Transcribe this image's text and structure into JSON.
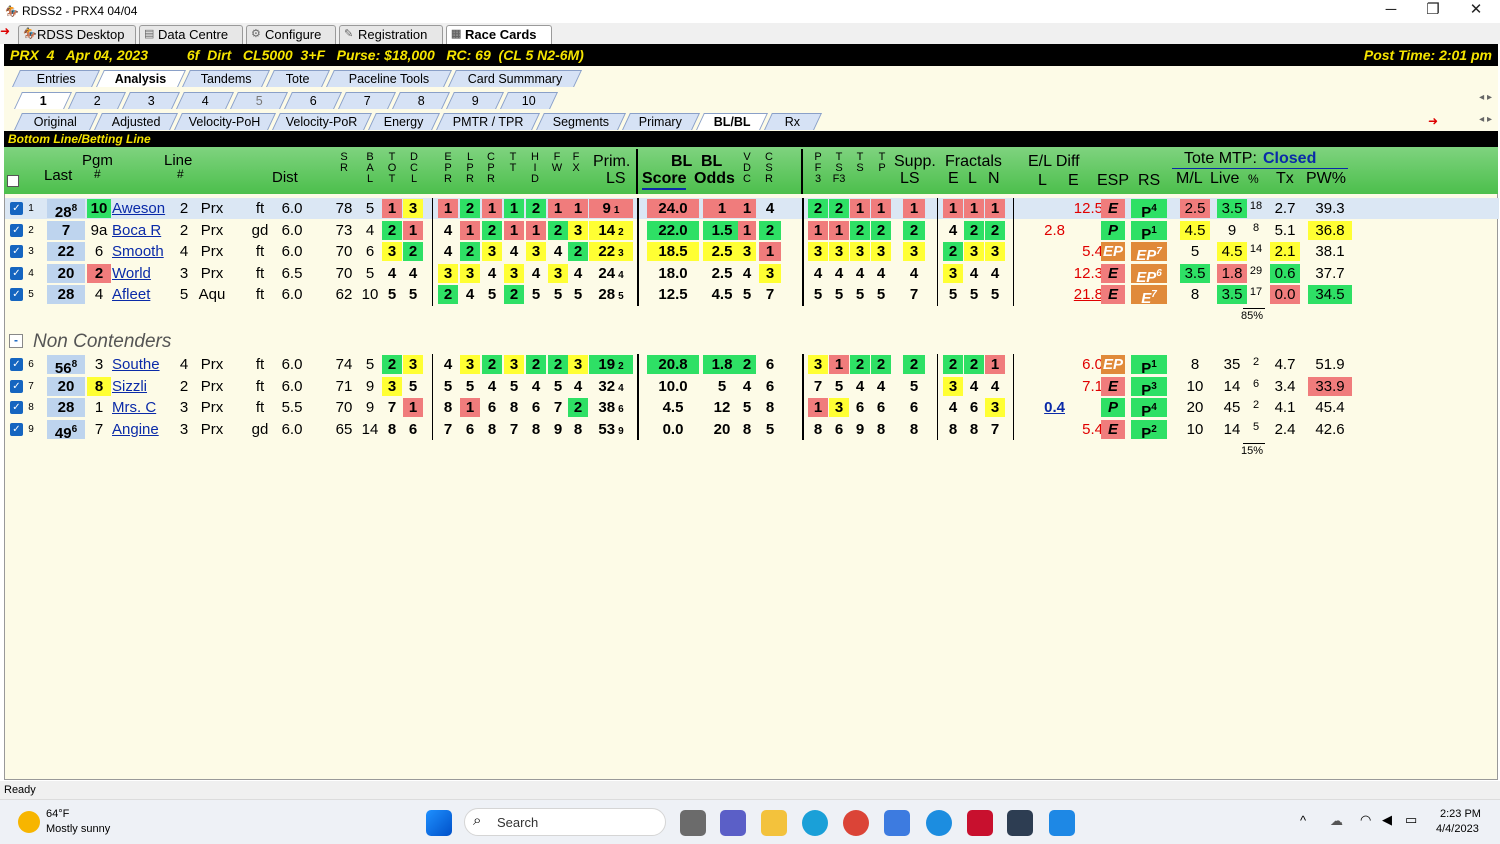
{
  "window": {
    "title": "RDSS2 - PRX4  04/04",
    "minimize": "─",
    "maximize": "❐",
    "close": "✕"
  },
  "app_tabs": [
    "RDSS Desktop",
    "Data Centre",
    "Configure",
    "Registration",
    "Race Cards"
  ],
  "race": {
    "left": "PRX  4   Apr 04, 2023          6f  Dirt   CL5000  3+F   Purse: $18,000   RC: 69  (CL 5 N2-6M)",
    "post": "Post Time: 2:01 pm"
  },
  "main_tabs": [
    "Entries",
    "Analysis",
    "Tandems",
    "Tote",
    "Paceline Tools",
    "Card Summmary"
  ],
  "race_tabs": [
    "1",
    "2",
    "3",
    "4",
    "5",
    "6",
    "7",
    "8",
    "9",
    "10"
  ],
  "view_tabs": [
    "Original",
    "Adjusted",
    "Velocity-PoH",
    "Velocity-PoR",
    "Energy",
    "PMTR / TPR",
    "Segments",
    "Primary",
    "BL/BL",
    "Rx"
  ],
  "section_title": "Bottom Line/Betting Line",
  "headers": {
    "last": "Last",
    "pgm": "Pgm",
    "pgm_sub": "#",
    "line": "Line",
    "line_sub": "#",
    "dist": "Dist",
    "sr": [
      "S",
      "R"
    ],
    "bal": [
      "B",
      "A",
      "L"
    ],
    "tot": [
      "T",
      "O",
      "T"
    ],
    "dcl": [
      "D",
      "C",
      "L"
    ],
    "epr": [
      "E",
      "P",
      "R"
    ],
    "lpr": [
      "L",
      "P",
      "R"
    ],
    "cpr": [
      "C",
      "P",
      "R"
    ],
    "tt": [
      "T",
      "T"
    ],
    "hid": [
      "H",
      "I",
      "D"
    ],
    "fw": [
      "F",
      "W"
    ],
    "fx": [
      "F",
      "X"
    ],
    "prim": "Prim.",
    "prim_ls": "LS",
    "bl1": "BL",
    "bl2": "BL",
    "score": "Score",
    "odds": "Odds",
    "vdc": [
      "V",
      "D",
      "C"
    ],
    "csr": [
      "C",
      "S",
      "R"
    ],
    "pf3": [
      "P",
      "F",
      "3"
    ],
    "ts": [
      "T",
      "S",
      "F3"
    ],
    "tss": [
      "T",
      "S"
    ],
    "tp": [
      "T",
      "P"
    ],
    "supp": "Supp.",
    "supp_ls": "LS",
    "fractals": "Fractals",
    "fe": "E",
    "fl": "L",
    "fn": "N",
    "eldiff": "E/L Diff",
    "el_l": "L",
    "el_e": "E",
    "esp": "ESP",
    "rs": "RS",
    "tote": "Tote MTP:",
    "tote_status": "Closed",
    "ml": "M/L",
    "live": "Live",
    "pct": "%",
    "tx": "Tx",
    "pw": "PW%"
  },
  "contenders": [
    {
      "n": "1",
      "last": "28",
      "last_sup": "8",
      "pgm": "10",
      "horse": "Aweson",
      "line": "2",
      "trk": "Prx",
      "cond": "ft",
      "dist": "6.0",
      "sr": "78",
      "bal": "5",
      "tot": "1",
      "dcl": "3",
      "epr": "1",
      "lpr": "2",
      "cpr": "1",
      "tt": "1",
      "hid": "2",
      "fw": "1",
      "fx": "1",
      "prim": "9",
      "prim_r": "1",
      "score": "24.0",
      "odds": "1",
      "vdc": "1",
      "csr": "4",
      "pf3": "2",
      "ts": "2",
      "tss": "1",
      "tp": "1",
      "supp": "1",
      "fe": "1",
      "fl": "1",
      "fn": "1",
      "el_l": "",
      "el_e": "12.5",
      "esp": "E",
      "rs": "P",
      "rs_sup": "4",
      "ml": "2.5",
      "live": "3.5",
      "pct": "18",
      "tx": "2.7",
      "pw": "39.3"
    },
    {
      "n": "2",
      "last": "7",
      "last_sup": "",
      "pgm": "9a",
      "horse": "Boca R",
      "line": "2",
      "trk": "Prx",
      "cond": "gd",
      "dist": "6.0",
      "sr": "73",
      "bal": "4",
      "tot": "2",
      "dcl": "1",
      "epr": "4",
      "lpr": "1",
      "cpr": "2",
      "tt": "1",
      "hid": "1",
      "fw": "2",
      "fx": "3",
      "prim": "14",
      "prim_r": "2",
      "score": "22.0",
      "odds": "1.5",
      "vdc": "1",
      "csr": "2",
      "pf3": "1",
      "ts": "1",
      "tss": "2",
      "tp": "2",
      "supp": "2",
      "fe": "4",
      "fl": "2",
      "fn": "2",
      "el_l": "2.8",
      "el_e": "",
      "esp": "P",
      "rs": "P",
      "rs_sup": "1",
      "ml": "4.5",
      "live": "9",
      "pct": "8",
      "tx": "5.1",
      "pw": "36.8"
    },
    {
      "n": "3",
      "last": "22",
      "last_sup": "",
      "pgm": "6",
      "horse": "Smooth",
      "line": "4",
      "trk": "Prx",
      "cond": "ft",
      "dist": "6.0",
      "sr": "70",
      "bal": "6",
      "tot": "3",
      "dcl": "2",
      "epr": "4",
      "lpr": "2",
      "cpr": "3",
      "tt": "4",
      "hid": "3",
      "fw": "4",
      "fx": "2",
      "prim": "22",
      "prim_r": "3",
      "score": "18.5",
      "odds": "2.5",
      "vdc": "3",
      "csr": "1",
      "pf3": "3",
      "ts": "3",
      "tss": "3",
      "tp": "3",
      "supp": "3",
      "fe": "2",
      "fl": "3",
      "fn": "3",
      "el_l": "",
      "el_e": "5.4",
      "esp": "EP",
      "rs": "EP",
      "rs_sup": "7",
      "ml": "5",
      "live": "4.5",
      "pct": "14",
      "tx": "2.1",
      "pw": "38.1"
    },
    {
      "n": "4",
      "last": "20",
      "last_sup": "",
      "pgm": "2",
      "horse": "World",
      "line": "3",
      "trk": "Prx",
      "cond": "ft",
      "dist": "6.5",
      "sr": "70",
      "bal": "5",
      "tot": "4",
      "dcl": "4",
      "epr": "3",
      "lpr": "3",
      "cpr": "4",
      "tt": "3",
      "hid": "4",
      "fw": "3",
      "fx": "4",
      "prim": "24",
      "prim_r": "4",
      "score": "18.0",
      "odds": "2.5",
      "vdc": "4",
      "csr": "3",
      "pf3": "4",
      "ts": "4",
      "tss": "4",
      "tp": "4",
      "supp": "4",
      "fe": "3",
      "fl": "4",
      "fn": "4",
      "el_l": "",
      "el_e": "12.3",
      "esp": "E",
      "rs": "EP",
      "rs_sup": "6",
      "ml": "3.5",
      "live": "1.8",
      "pct": "29",
      "tx": "0.6",
      "pw": "37.7"
    },
    {
      "n": "5",
      "last": "28",
      "last_sup": "",
      "pgm": "4",
      "horse": "Afleet",
      "line": "5",
      "trk": "Aqu",
      "cond": "ft",
      "dist": "6.0",
      "sr": "62",
      "bal": "10",
      "tot": "5",
      "dcl": "5",
      "epr": "2",
      "lpr": "4",
      "cpr": "5",
      "tt": "2",
      "hid": "5",
      "fw": "5",
      "fx": "5",
      "prim": "28",
      "prim_r": "5",
      "score": "12.5",
      "odds": "4.5",
      "vdc": "5",
      "csr": "7",
      "pf3": "5",
      "ts": "5",
      "tss": "5",
      "tp": "5",
      "supp": "7",
      "fe": "5",
      "fl": "5",
      "fn": "5",
      "el_l": "",
      "el_e": "21.8",
      "esp": "E",
      "rs": "E",
      "rs_sup": "7",
      "ml": "8",
      "live": "3.5",
      "pct": "17",
      "tx": "0.0",
      "pw": "34.5"
    }
  ],
  "contenders_total": "85%",
  "non_contenders_label": "Non Contenders",
  "collapse": "-",
  "non_contenders": [
    {
      "n": "6",
      "last": "56",
      "last_sup": "8",
      "pgm": "3",
      "horse": "Southe",
      "line": "4",
      "trk": "Prx",
      "cond": "ft",
      "dist": "6.0",
      "sr": "74",
      "bal": "5",
      "tot": "2",
      "dcl": "3",
      "epr": "4",
      "lpr": "3",
      "cpr": "2",
      "tt": "3",
      "hid": "2",
      "fw": "2",
      "fx": "3",
      "prim": "19",
      "prim_r": "2",
      "score": "20.8",
      "odds": "1.8",
      "vdc": "2",
      "csr": "6",
      "pf3": "3",
      "ts": "1",
      "tss": "2",
      "tp": "2",
      "supp": "2",
      "fe": "2",
      "fl": "2",
      "fn": "1",
      "el_l": "",
      "el_e": "6.0",
      "esp": "EP",
      "rs": "P",
      "rs_sup": "1",
      "ml": "8",
      "live": "35",
      "pct": "2",
      "tx": "4.7",
      "pw": "51.9"
    },
    {
      "n": "7",
      "last": "20",
      "last_sup": "",
      "pgm": "8",
      "horse": "Sizzli",
      "line": "2",
      "trk": "Prx",
      "cond": "ft",
      "dist": "6.0",
      "sr": "71",
      "bal": "9",
      "tot": "3",
      "dcl": "5",
      "epr": "5",
      "lpr": "5",
      "cpr": "4",
      "tt": "5",
      "hid": "4",
      "fw": "5",
      "fx": "4",
      "prim": "32",
      "prim_r": "4",
      "score": "10.0",
      "odds": "5",
      "vdc": "4",
      "csr": "6",
      "pf3": "7",
      "ts": "5",
      "tss": "4",
      "tp": "4",
      "supp": "5",
      "fe": "3",
      "fl": "4",
      "fn": "4",
      "el_l": "",
      "el_e": "7.1",
      "esp": "E",
      "rs": "P",
      "rs_sup": "3",
      "ml": "10",
      "live": "14",
      "pct": "6",
      "tx": "3.4",
      "pw": "33.9"
    },
    {
      "n": "8",
      "last": "28",
      "last_sup": "",
      "pgm": "1",
      "horse": "Mrs. C",
      "line": "3",
      "trk": "Prx",
      "cond": "ft",
      "dist": "5.5",
      "sr": "70",
      "bal": "9",
      "tot": "7",
      "dcl": "1",
      "epr": "8",
      "lpr": "1",
      "cpr": "6",
      "tt": "8",
      "hid": "6",
      "fw": "7",
      "fx": "2",
      "prim": "38",
      "prim_r": "6",
      "score": "4.5",
      "odds": "12",
      "vdc": "5",
      "csr": "8",
      "pf3": "1",
      "ts": "3",
      "tss": "6",
      "tp": "6",
      "supp": "6",
      "fe": "4",
      "fl": "6",
      "fn": "3",
      "el_l": "0.4",
      "el_e": "",
      "esp": "P",
      "rs": "P",
      "rs_sup": "4",
      "ml": "20",
      "live": "45",
      "pct": "2",
      "tx": "4.1",
      "pw": "45.4"
    },
    {
      "n": "9",
      "last": "49",
      "last_sup": "6",
      "pgm": "7",
      "horse": "Angine",
      "line": "3",
      "trk": "Prx",
      "cond": "gd",
      "dist": "6.0",
      "sr": "65",
      "bal": "14",
      "tot": "8",
      "dcl": "6",
      "epr": "7",
      "lpr": "6",
      "cpr": "8",
      "tt": "7",
      "hid": "8",
      "fw": "9",
      "fx": "8",
      "prim": "53",
      "prim_r": "9",
      "score": "0.0",
      "odds": "20",
      "vdc": "8",
      "csr": "5",
      "pf3": "8",
      "ts": "6",
      "tss": "9",
      "tp": "8",
      "supp": "8",
      "fe": "8",
      "fl": "8",
      "fn": "7",
      "el_l": "",
      "el_e": "5.4",
      "esp": "E",
      "rs": "P",
      "rs_sup": "2",
      "ml": "10",
      "live": "14",
      "pct": "5",
      "tx": "2.4",
      "pw": "42.6"
    }
  ],
  "non_contenders_total": "15%",
  "status": "Ready",
  "taskbar": {
    "temp": "64°F",
    "weather": "Mostly sunny",
    "search": "Search",
    "time": "2:23 PM",
    "date": "4/4/2023"
  },
  "colors": {
    "green": "#2ee065",
    "yellow": "#ffff33",
    "red": "#f07c7c",
    "orange": "#e08a3a",
    "header_green": "#4cbf4c",
    "race_bar": "#000000",
    "race_text": "#f5e400"
  },
  "highlights": {
    "contenders": [
      {
        "last": "lb",
        "pgm": "g",
        "tot": "r",
        "dcl": "y",
        "epr": "r",
        "lpr": "g",
        "cpr": "r",
        "tt": "g",
        "hid": "g",
        "fw": "r",
        "fx": "r",
        "prim": "r",
        "score": "r",
        "odds": "r",
        "vdc": "r",
        "csr": "",
        "pf3": "g",
        "ts": "g",
        "tss": "r",
        "tp": "r",
        "supp": "r",
        "fe": "r",
        "fl": "r",
        "fn": "r",
        "esp": "r",
        "rs": "g",
        "ml": "r",
        "live": "g",
        "tx": "",
        "pw": ""
      },
      {
        "last": "lb",
        "pgm": "",
        "tot": "g",
        "dcl": "r",
        "epr": "",
        "lpr": "r",
        "cpr": "g",
        "tt": "r",
        "hid": "r",
        "fw": "g",
        "fx": "y",
        "prim": "y",
        "score": "g",
        "odds": "g",
        "vdc": "r",
        "csr": "g",
        "pf3": "r",
        "ts": "r",
        "tss": "g",
        "tp": "g",
        "supp": "g",
        "fe": "",
        "fl": "g",
        "fn": "g",
        "esp": "g",
        "rs": "g",
        "ml": "y",
        "live": "",
        "tx": "",
        "pw": "y"
      },
      {
        "last": "lb",
        "pgm": "",
        "tot": "y",
        "dcl": "g",
        "epr": "",
        "lpr": "g",
        "cpr": "y",
        "tt": "",
        "hid": "y",
        "fw": "",
        "fx": "g",
        "prim": "y",
        "score": "y",
        "odds": "y",
        "vdc": "y",
        "csr": "r",
        "pf3": "y",
        "ts": "y",
        "tss": "y",
        "tp": "y",
        "supp": "y",
        "fe": "g",
        "fl": "y",
        "fn": "y",
        "esp": "o",
        "rs": "o",
        "ml": "",
        "live": "y",
        "tx": "y",
        "pw": ""
      },
      {
        "last": "lb",
        "pgm": "r",
        "tot": "",
        "dcl": "",
        "epr": "y",
        "lpr": "y",
        "cpr": "",
        "tt": "y",
        "hid": "",
        "fw": "y",
        "fx": "",
        "prim": "",
        "score": "",
        "odds": "",
        "vdc": "",
        "csr": "y",
        "pf3": "",
        "ts": "",
        "tss": "",
        "tp": "",
        "supp": "",
        "fe": "y",
        "fl": "",
        "fn": "",
        "esp": "r",
        "rs": "o",
        "ml": "g",
        "live": "r",
        "tx": "g",
        "pw": ""
      },
      {
        "last": "lb",
        "pgm": "",
        "tot": "",
        "dcl": "",
        "epr": "g",
        "lpr": "",
        "cpr": "",
        "tt": "g",
        "hid": "",
        "fw": "",
        "fx": "",
        "prim": "",
        "score": "",
        "odds": "",
        "vdc": "",
        "csr": "",
        "pf3": "",
        "ts": "",
        "tss": "",
        "tp": "",
        "supp": "",
        "fe": "",
        "fl": "",
        "fn": "",
        "esp": "r",
        "rs": "o",
        "ml": "",
        "live": "g",
        "tx": "r",
        "pw": "g"
      }
    ],
    "non_contenders": [
      {
        "last": "lb",
        "pgm": "",
        "tot": "g",
        "dcl": "y",
        "epr": "",
        "lpr": "y",
        "cpr": "g",
        "tt": "y",
        "hid": "g",
        "fw": "g",
        "fx": "y",
        "prim": "g",
        "score": "g",
        "odds": "g",
        "vdc": "g",
        "csr": "",
        "pf3": "y",
        "ts": "r",
        "tss": "g",
        "tp": "g",
        "supp": "g",
        "fe": "g",
        "fl": "g",
        "fn": "r",
        "esp": "o",
        "rs": "g",
        "ml": "",
        "live": "",
        "tx": "",
        "pw": ""
      },
      {
        "last": "lb",
        "pgm": "y",
        "tot": "y",
        "dcl": "",
        "epr": "",
        "lpr": "",
        "cpr": "",
        "tt": "",
        "hid": "",
        "fw": "",
        "fx": "",
        "prim": "",
        "score": "",
        "odds": "",
        "vdc": "",
        "csr": "",
        "pf3": "",
        "ts": "",
        "tss": "",
        "tp": "",
        "supp": "",
        "fe": "y",
        "fl": "",
        "fn": "",
        "esp": "r",
        "rs": "g",
        "ml": "",
        "live": "",
        "tx": "",
        "pw": "r"
      },
      {
        "last": "lb",
        "pgm": "",
        "tot": "",
        "dcl": "r",
        "epr": "",
        "lpr": "r",
        "cpr": "",
        "tt": "",
        "hid": "",
        "fw": "",
        "fx": "g",
        "prim": "",
        "score": "",
        "odds": "",
        "vdc": "",
        "csr": "",
        "pf3": "r",
        "ts": "y",
        "tss": "",
        "tp": "",
        "supp": "",
        "fe": "",
        "fl": "",
        "fn": "y",
        "esp": "g",
        "rs": "g",
        "ml": "",
        "live": "",
        "tx": "",
        "pw": ""
      },
      {
        "last": "lb",
        "pgm": "",
        "tot": "",
        "dcl": "",
        "epr": "",
        "lpr": "",
        "cpr": "",
        "tt": "",
        "hid": "",
        "fw": "",
        "fx": "",
        "prim": "",
        "score": "",
        "odds": "",
        "vdc": "",
        "csr": "",
        "pf3": "",
        "ts": "",
        "tss": "",
        "tp": "",
        "supp": "",
        "fe": "",
        "fl": "",
        "fn": "",
        "esp": "r",
        "rs": "g",
        "ml": "",
        "live": "",
        "tx": "",
        "pw": ""
      }
    ]
  }
}
